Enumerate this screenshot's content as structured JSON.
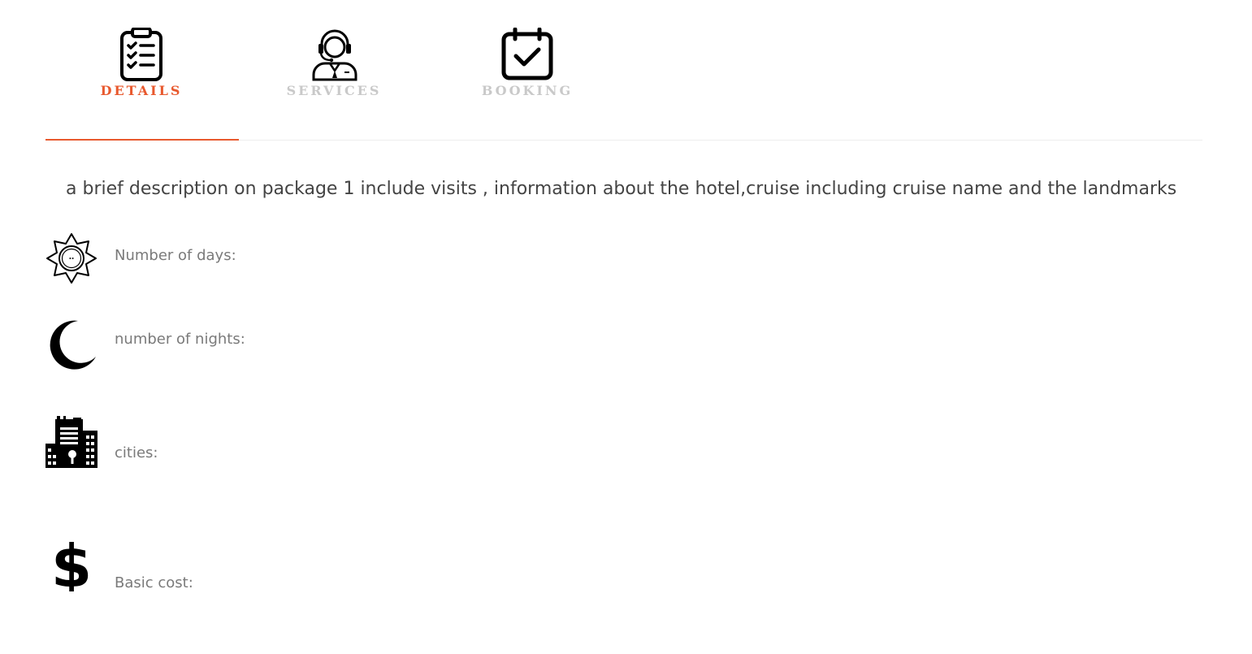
{
  "tabs": [
    {
      "label": "DETAILS",
      "icon": "clipboard-checklist-icon",
      "active": true
    },
    {
      "label": "SERVICES",
      "icon": "customer-support-agent-icon",
      "active": false
    },
    {
      "label": "BOOKING",
      "icon": "calendar-check-icon",
      "active": false
    }
  ],
  "colors": {
    "accent": "#e8592e",
    "inactive_tab": "#c9c9c9",
    "text": "#444444",
    "label": "#7a7a7a"
  },
  "description": "a brief description on package 1 include visits , information about the hotel,cruise including cruise name and the landmarks",
  "details": [
    {
      "label": "Number of days:",
      "icon": "sun-icon"
    },
    {
      "label": "number of nights:",
      "icon": "moon-icon"
    },
    {
      "label": "cities:",
      "icon": "city-buildings-icon"
    },
    {
      "label": "Basic cost:",
      "icon": "dollar-icon"
    }
  ]
}
